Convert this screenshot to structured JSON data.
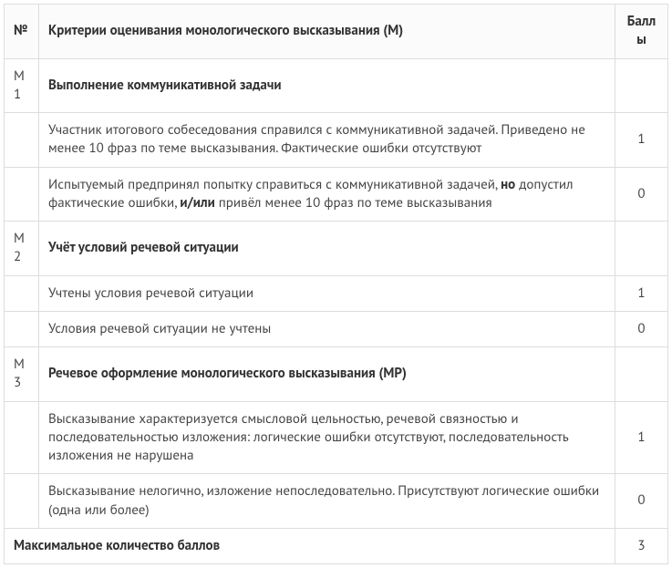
{
  "table": {
    "headers": {
      "num": "№",
      "criteria": "Критерии оценивания монологического высказывания (М)",
      "score": "Баллы"
    },
    "sections": [
      {
        "code": "М1",
        "title": "Выполнение коммуникативной задачи",
        "rows": [
          {
            "desc_pre": "Участник итогового собеседования справился с коммуникативной задачей. Приведено не менее 10 фраз по теме высказывания. Фактические ошибки отсутствуют",
            "score": "1"
          },
          {
            "desc_pre": "Испытуемый предпринял попытку справиться с коммуникативной задачей, ",
            "bold1": "но",
            "desc_mid": " допустил фактические ошибки, ",
            "bold2": "и/или",
            "desc_post": " привёл менее 10 фраз по теме высказывания",
            "score": "0"
          }
        ]
      },
      {
        "code": "М2",
        "title": "Учёт условий речевой ситуации",
        "rows": [
          {
            "desc_pre": "Учтены условия речевой ситуации",
            "score": "1"
          },
          {
            "desc_pre": "Условия речевой ситуации не учтены",
            "score": "0"
          }
        ]
      },
      {
        "code": "М3",
        "title": "Речевое оформление монологического высказывания (МР)",
        "rows": [
          {
            "desc_pre": "Высказывание характеризуется смысловой цельностью, речевой связностью и последовательностью изложения: логические ошибки отсутствуют, последовательность изложения не нарушена",
            "score": "1"
          },
          {
            "desc_pre": "Высказывание нелогично, изложение непоследовательно. Присутствуют логические ошибки (одна или более)",
            "score": "0"
          }
        ]
      }
    ],
    "footer": {
      "label": "Максимальное количество баллов",
      "score": "3"
    }
  }
}
